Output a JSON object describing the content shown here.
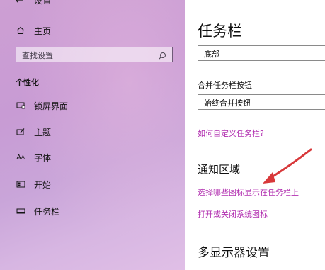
{
  "sidebar": {
    "back_label": "设置",
    "home_label": "主页",
    "search_placeholder": "查找设置",
    "section_title": "个性化",
    "items": [
      {
        "label": "锁屏界面",
        "icon": "lock-screen-icon"
      },
      {
        "label": "主题",
        "icon": "theme-icon"
      },
      {
        "label": "字体",
        "icon": "font-icon"
      },
      {
        "label": "开始",
        "icon": "start-icon"
      },
      {
        "label": "任务栏",
        "icon": "taskbar-icon"
      }
    ]
  },
  "main": {
    "title": "任务栏",
    "position_value": "底部",
    "combine_label": "合并任务栏按钮",
    "combine_value": "始终合并按钮",
    "customize_link": "如何自定义任务栏?",
    "notification_heading": "通知区域",
    "select_icons_link": "选择哪些图标显示在任务栏上",
    "system_icons_link": "打开或关闭系统图标",
    "multi_display_heading": "多显示器设置"
  },
  "colors": {
    "accent_link": "#b22fb0",
    "arrow": "#d8383a",
    "sidebar_bg": "#c89bd4"
  }
}
